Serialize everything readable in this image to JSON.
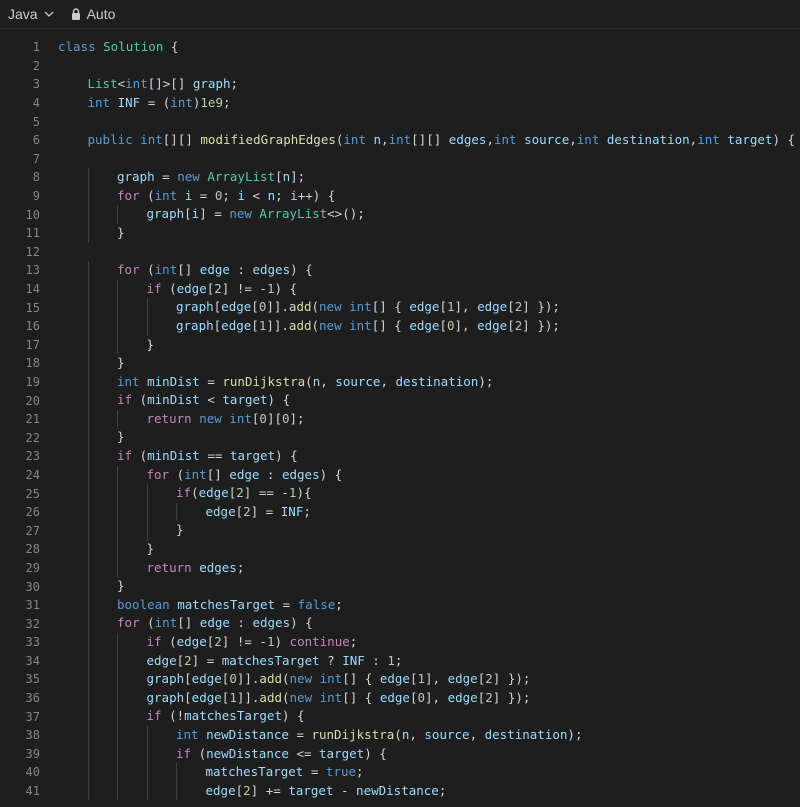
{
  "toolbar": {
    "language": "Java",
    "mode": "Auto"
  },
  "lines": [
    {
      "n": "1",
      "indent": 0,
      "t": [
        [
          "k",
          "class "
        ],
        [
          "t",
          "Solution"
        ],
        [
          "p",
          " {"
        ]
      ]
    },
    {
      "n": "2",
      "indent": 0,
      "t": []
    },
    {
      "n": "3",
      "indent": 1,
      "t": [
        [
          "t",
          "List"
        ],
        [
          "p",
          "<"
        ],
        [
          "k",
          "int"
        ],
        [
          "p",
          "[]>[] "
        ],
        [
          "v",
          "graph"
        ],
        [
          "p",
          ";"
        ]
      ]
    },
    {
      "n": "4",
      "indent": 1,
      "t": [
        [
          "k",
          "int "
        ],
        [
          "v",
          "INF"
        ],
        [
          "p",
          " = ("
        ],
        [
          "k",
          "int"
        ],
        [
          "p",
          ")"
        ],
        [
          "n",
          "1e9"
        ],
        [
          "p",
          ";"
        ]
      ]
    },
    {
      "n": "5",
      "indent": 0,
      "t": []
    },
    {
      "n": "6",
      "indent": 1,
      "t": [
        [
          "k",
          "public int"
        ],
        [
          "p",
          "[][] "
        ],
        [
          "f",
          "modifiedGraphEdges"
        ],
        [
          "p",
          "("
        ],
        [
          "k",
          "int "
        ],
        [
          "v",
          "n"
        ],
        [
          "p",
          ","
        ],
        [
          "k",
          "int"
        ],
        [
          "p",
          "[][] "
        ],
        [
          "v",
          "edges"
        ],
        [
          "p",
          ","
        ],
        [
          "k",
          "int "
        ],
        [
          "v",
          "source"
        ],
        [
          "p",
          ","
        ],
        [
          "k",
          "int "
        ],
        [
          "v",
          "destination"
        ],
        [
          "p",
          ","
        ],
        [
          "k",
          "int "
        ],
        [
          "v",
          "target"
        ],
        [
          "p",
          ") {"
        ]
      ]
    },
    {
      "n": "7",
      "indent": 0,
      "t": []
    },
    {
      "n": "8",
      "indent": 2,
      "t": [
        [
          "v",
          "graph"
        ],
        [
          "p",
          " = "
        ],
        [
          "k",
          "new "
        ],
        [
          "t",
          "ArrayList"
        ],
        [
          "p",
          "["
        ],
        [
          "v",
          "n"
        ],
        [
          "p",
          "];"
        ]
      ]
    },
    {
      "n": "9",
      "indent": 2,
      "t": [
        [
          "c",
          "for"
        ],
        [
          "p",
          " ("
        ],
        [
          "k",
          "int "
        ],
        [
          "v",
          "i"
        ],
        [
          "p",
          " = "
        ],
        [
          "n",
          "0"
        ],
        [
          "p",
          "; "
        ],
        [
          "v",
          "i"
        ],
        [
          "p",
          " < "
        ],
        [
          "v",
          "n"
        ],
        [
          "p",
          "; "
        ],
        [
          "v",
          "i"
        ],
        [
          "p",
          "++) {"
        ]
      ]
    },
    {
      "n": "10",
      "indent": 3,
      "t": [
        [
          "v",
          "graph"
        ],
        [
          "p",
          "["
        ],
        [
          "v",
          "i"
        ],
        [
          "p",
          "] = "
        ],
        [
          "k",
          "new "
        ],
        [
          "t",
          "ArrayList"
        ],
        [
          "p",
          "<>();"
        ]
      ]
    },
    {
      "n": "11",
      "indent": 2,
      "t": [
        [
          "p",
          "}"
        ]
      ]
    },
    {
      "n": "12",
      "indent": 0,
      "t": []
    },
    {
      "n": "13",
      "indent": 2,
      "t": [
        [
          "c",
          "for"
        ],
        [
          "p",
          " ("
        ],
        [
          "k",
          "int"
        ],
        [
          "p",
          "[] "
        ],
        [
          "v",
          "edge"
        ],
        [
          "p",
          " : "
        ],
        [
          "v",
          "edges"
        ],
        [
          "p",
          ") {"
        ]
      ]
    },
    {
      "n": "14",
      "indent": 3,
      "t": [
        [
          "c",
          "if"
        ],
        [
          "p",
          " ("
        ],
        [
          "v",
          "edge"
        ],
        [
          "p",
          "["
        ],
        [
          "n",
          "2"
        ],
        [
          "p",
          "] != -"
        ],
        [
          "n",
          "1"
        ],
        [
          "p",
          ") {"
        ]
      ]
    },
    {
      "n": "15",
      "indent": 4,
      "t": [
        [
          "v",
          "graph"
        ],
        [
          "p",
          "["
        ],
        [
          "v",
          "edge"
        ],
        [
          "p",
          "["
        ],
        [
          "n",
          "0"
        ],
        [
          "p",
          "]]."
        ],
        [
          "f",
          "add"
        ],
        [
          "p",
          "("
        ],
        [
          "k",
          "new int"
        ],
        [
          "p",
          "[] { "
        ],
        [
          "v",
          "edge"
        ],
        [
          "p",
          "["
        ],
        [
          "n",
          "1"
        ],
        [
          "p",
          "], "
        ],
        [
          "v",
          "edge"
        ],
        [
          "p",
          "["
        ],
        [
          "n",
          "2"
        ],
        [
          "p",
          "] });"
        ]
      ]
    },
    {
      "n": "16",
      "indent": 4,
      "t": [
        [
          "v",
          "graph"
        ],
        [
          "p",
          "["
        ],
        [
          "v",
          "edge"
        ],
        [
          "p",
          "["
        ],
        [
          "n",
          "1"
        ],
        [
          "p",
          "]]."
        ],
        [
          "f",
          "add"
        ],
        [
          "p",
          "("
        ],
        [
          "k",
          "new int"
        ],
        [
          "p",
          "[] { "
        ],
        [
          "v",
          "edge"
        ],
        [
          "p",
          "["
        ],
        [
          "n",
          "0"
        ],
        [
          "p",
          "], "
        ],
        [
          "v",
          "edge"
        ],
        [
          "p",
          "["
        ],
        [
          "n",
          "2"
        ],
        [
          "p",
          "] });"
        ]
      ]
    },
    {
      "n": "17",
      "indent": 3,
      "t": [
        [
          "p",
          "}"
        ]
      ]
    },
    {
      "n": "18",
      "indent": 2,
      "t": [
        [
          "p",
          "}"
        ]
      ]
    },
    {
      "n": "19",
      "indent": 2,
      "t": [
        [
          "k",
          "int "
        ],
        [
          "v",
          "minDist"
        ],
        [
          "p",
          " = "
        ],
        [
          "f",
          "runDijkstra"
        ],
        [
          "p",
          "("
        ],
        [
          "v",
          "n"
        ],
        [
          "p",
          ", "
        ],
        [
          "v",
          "source"
        ],
        [
          "p",
          ", "
        ],
        [
          "v",
          "destination"
        ],
        [
          "p",
          ");"
        ]
      ]
    },
    {
      "n": "20",
      "indent": 2,
      "t": [
        [
          "c",
          "if"
        ],
        [
          "p",
          " ("
        ],
        [
          "v",
          "minDist"
        ],
        [
          "p",
          " < "
        ],
        [
          "v",
          "target"
        ],
        [
          "p",
          ") {"
        ]
      ]
    },
    {
      "n": "21",
      "indent": 3,
      "t": [
        [
          "c",
          "return "
        ],
        [
          "k",
          "new int"
        ],
        [
          "p",
          "["
        ],
        [
          "n",
          "0"
        ],
        [
          "p",
          "]["
        ],
        [
          "n",
          "0"
        ],
        [
          "p",
          "];"
        ]
      ]
    },
    {
      "n": "22",
      "indent": 2,
      "t": [
        [
          "p",
          "}"
        ]
      ]
    },
    {
      "n": "23",
      "indent": 2,
      "t": [
        [
          "c",
          "if"
        ],
        [
          "p",
          " ("
        ],
        [
          "v",
          "minDist"
        ],
        [
          "p",
          " == "
        ],
        [
          "v",
          "target"
        ],
        [
          "p",
          ") {"
        ]
      ]
    },
    {
      "n": "24",
      "indent": 3,
      "t": [
        [
          "c",
          "for"
        ],
        [
          "p",
          " ("
        ],
        [
          "k",
          "int"
        ],
        [
          "p",
          "[] "
        ],
        [
          "v",
          "edge"
        ],
        [
          "p",
          " : "
        ],
        [
          "v",
          "edges"
        ],
        [
          "p",
          ") {"
        ]
      ]
    },
    {
      "n": "25",
      "indent": 4,
      "t": [
        [
          "c",
          "if"
        ],
        [
          "p",
          "("
        ],
        [
          "v",
          "edge"
        ],
        [
          "p",
          "["
        ],
        [
          "n",
          "2"
        ],
        [
          "p",
          "] == -"
        ],
        [
          "n",
          "1"
        ],
        [
          "p",
          "){"
        ]
      ]
    },
    {
      "n": "26",
      "indent": 5,
      "t": [
        [
          "v",
          "edge"
        ],
        [
          "p",
          "["
        ],
        [
          "n",
          "2"
        ],
        [
          "p",
          "] = "
        ],
        [
          "v",
          "INF"
        ],
        [
          "p",
          ";"
        ]
      ]
    },
    {
      "n": "27",
      "indent": 4,
      "t": [
        [
          "p",
          "}"
        ]
      ]
    },
    {
      "n": "28",
      "indent": 3,
      "t": [
        [
          "p",
          "}"
        ]
      ]
    },
    {
      "n": "29",
      "indent": 3,
      "t": [
        [
          "c",
          "return "
        ],
        [
          "v",
          "edges"
        ],
        [
          "p",
          ";"
        ]
      ]
    },
    {
      "n": "30",
      "indent": 2,
      "t": [
        [
          "p",
          "}"
        ]
      ]
    },
    {
      "n": "31",
      "indent": 2,
      "t": [
        [
          "k",
          "boolean "
        ],
        [
          "v",
          "matchesTarget"
        ],
        [
          "p",
          " = "
        ],
        [
          "b",
          "false"
        ],
        [
          "p",
          ";"
        ]
      ]
    },
    {
      "n": "32",
      "indent": 2,
      "t": [
        [
          "c",
          "for"
        ],
        [
          "p",
          " ("
        ],
        [
          "k",
          "int"
        ],
        [
          "p",
          "[] "
        ],
        [
          "v",
          "edge"
        ],
        [
          "p",
          " : "
        ],
        [
          "v",
          "edges"
        ],
        [
          "p",
          ") {"
        ]
      ]
    },
    {
      "n": "33",
      "indent": 3,
      "t": [
        [
          "c",
          "if"
        ],
        [
          "p",
          " ("
        ],
        [
          "v",
          "edge"
        ],
        [
          "p",
          "["
        ],
        [
          "n",
          "2"
        ],
        [
          "p",
          "] != -"
        ],
        [
          "n",
          "1"
        ],
        [
          "p",
          ") "
        ],
        [
          "c",
          "continue"
        ],
        [
          "p",
          ";"
        ]
      ]
    },
    {
      "n": "34",
      "indent": 3,
      "t": [
        [
          "v",
          "edge"
        ],
        [
          "p",
          "["
        ],
        [
          "n",
          "2"
        ],
        [
          "p",
          "] = "
        ],
        [
          "v",
          "matchesTarget"
        ],
        [
          "p",
          " ? "
        ],
        [
          "v",
          "INF"
        ],
        [
          "p",
          " : "
        ],
        [
          "n",
          "1"
        ],
        [
          "p",
          ";"
        ]
      ]
    },
    {
      "n": "35",
      "indent": 3,
      "t": [
        [
          "v",
          "graph"
        ],
        [
          "p",
          "["
        ],
        [
          "v",
          "edge"
        ],
        [
          "p",
          "["
        ],
        [
          "n",
          "0"
        ],
        [
          "p",
          "]]."
        ],
        [
          "f",
          "add"
        ],
        [
          "p",
          "("
        ],
        [
          "k",
          "new int"
        ],
        [
          "p",
          "[] { "
        ],
        [
          "v",
          "edge"
        ],
        [
          "p",
          "["
        ],
        [
          "n",
          "1"
        ],
        [
          "p",
          "], "
        ],
        [
          "v",
          "edge"
        ],
        [
          "p",
          "["
        ],
        [
          "n",
          "2"
        ],
        [
          "p",
          "] });"
        ]
      ]
    },
    {
      "n": "36",
      "indent": 3,
      "t": [
        [
          "v",
          "graph"
        ],
        [
          "p",
          "["
        ],
        [
          "v",
          "edge"
        ],
        [
          "p",
          "["
        ],
        [
          "n",
          "1"
        ],
        [
          "p",
          "]]."
        ],
        [
          "f",
          "add"
        ],
        [
          "p",
          "("
        ],
        [
          "k",
          "new int"
        ],
        [
          "p",
          "[] { "
        ],
        [
          "v",
          "edge"
        ],
        [
          "p",
          "["
        ],
        [
          "n",
          "0"
        ],
        [
          "p",
          "], "
        ],
        [
          "v",
          "edge"
        ],
        [
          "p",
          "["
        ],
        [
          "n",
          "2"
        ],
        [
          "p",
          "] });"
        ]
      ]
    },
    {
      "n": "37",
      "indent": 3,
      "t": [
        [
          "c",
          "if"
        ],
        [
          "p",
          " (!"
        ],
        [
          "v",
          "matchesTarget"
        ],
        [
          "p",
          ") {"
        ]
      ]
    },
    {
      "n": "38",
      "indent": 4,
      "t": [
        [
          "k",
          "int "
        ],
        [
          "v",
          "newDistance"
        ],
        [
          "p",
          " = "
        ],
        [
          "f",
          "runDijkstra"
        ],
        [
          "p",
          "("
        ],
        [
          "v",
          "n"
        ],
        [
          "p",
          ", "
        ],
        [
          "v",
          "source"
        ],
        [
          "p",
          ", "
        ],
        [
          "v",
          "destination"
        ],
        [
          "p",
          ");"
        ]
      ]
    },
    {
      "n": "39",
      "indent": 4,
      "t": [
        [
          "c",
          "if"
        ],
        [
          "p",
          " ("
        ],
        [
          "v",
          "newDistance"
        ],
        [
          "p",
          " <= "
        ],
        [
          "v",
          "target"
        ],
        [
          "p",
          ") {"
        ]
      ]
    },
    {
      "n": "40",
      "indent": 5,
      "t": [
        [
          "v",
          "matchesTarget"
        ],
        [
          "p",
          " = "
        ],
        [
          "b",
          "true"
        ],
        [
          "p",
          ";"
        ]
      ]
    },
    {
      "n": "41",
      "indent": 5,
      "t": [
        [
          "v",
          "edge"
        ],
        [
          "p",
          "["
        ],
        [
          "n",
          "2"
        ],
        [
          "p",
          "] += "
        ],
        [
          "v",
          "target"
        ],
        [
          "p",
          " - "
        ],
        [
          "v",
          "newDistance"
        ],
        [
          "p",
          ";"
        ]
      ]
    }
  ]
}
